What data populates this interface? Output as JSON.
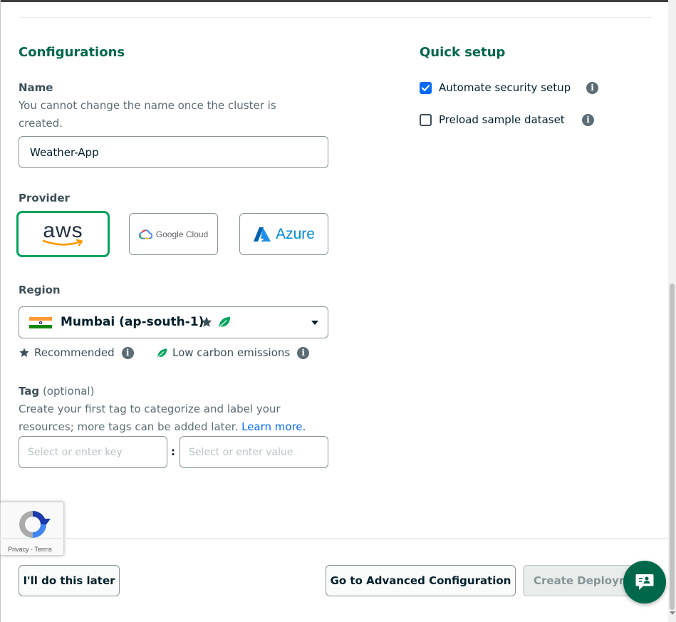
{
  "configurations": {
    "title": "Configurations",
    "name_label": "Name",
    "name_desc_line1": "You cannot change the name once the cluster is",
    "name_desc_line2": "created.",
    "name_value": "Weather-App",
    "provider_label": "Provider",
    "providers": [
      {
        "text": "aws",
        "selected": true
      },
      {
        "text": "Google Cloud",
        "selected": false
      },
      {
        "text": "Azure",
        "selected": false
      }
    ],
    "region_label": "Region",
    "region_value": "Mumbai (ap-south-1)",
    "legend_recommended": "Recommended",
    "legend_low_carbon": "Low carbon emissions",
    "tag_label": "Tag",
    "tag_optional": "(optional)",
    "tag_desc_line1": "Create your first tag to categorize and label your",
    "tag_desc_line2": "resources; more tags can be added later.",
    "tag_learn_more": "Learn more.",
    "tag_key_placeholder": "Select or enter key",
    "tag_separator": ":",
    "tag_value_placeholder": "Select or enter value"
  },
  "quick_setup": {
    "title": "Quick setup",
    "options": [
      {
        "label": "Automate security setup",
        "checked": true
      },
      {
        "label": "Preload sample dataset",
        "checked": false
      }
    ]
  },
  "recaptcha": {
    "terms": "Privacy - Terms"
  },
  "footer": {
    "later_label": "I'll do this later",
    "advanced_label": "Go to Advanced Configuration",
    "create_label": "Create Deployment"
  },
  "colors": {
    "accent_green": "#00684a",
    "selected_border": "#00a35c",
    "checkbox_blue": "#016bf8",
    "leaf_green": "#00a35c"
  },
  "icons": [
    "info-icon",
    "star-icon",
    "leaf-icon",
    "india-flag-icon",
    "chevron-down-icon",
    "chat-icon",
    "recaptcha-logo"
  ]
}
